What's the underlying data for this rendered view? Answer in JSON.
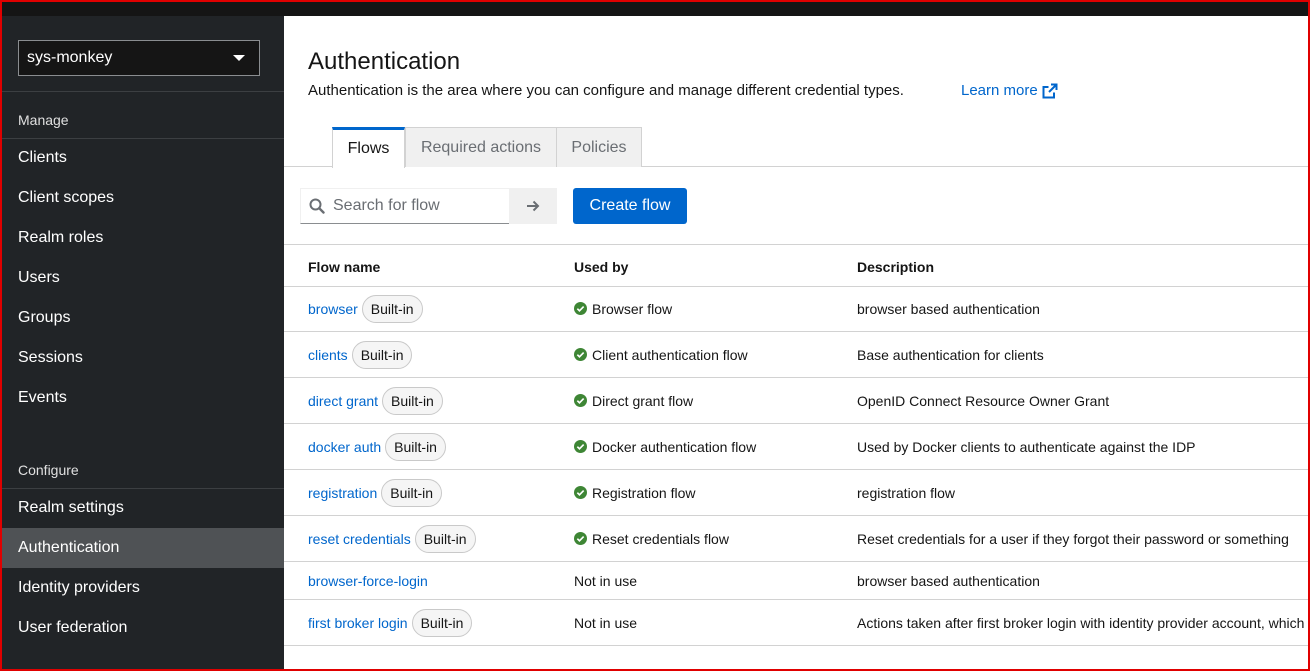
{
  "realm_selector": {
    "value": "sys-monkey"
  },
  "sidebar": {
    "manage_title": "Manage",
    "manage_items": [
      {
        "label": "Clients"
      },
      {
        "label": "Client scopes"
      },
      {
        "label": "Realm roles"
      },
      {
        "label": "Users"
      },
      {
        "label": "Groups"
      },
      {
        "label": "Sessions"
      },
      {
        "label": "Events"
      }
    ],
    "configure_title": "Configure",
    "configure_items": [
      {
        "label": "Realm settings"
      },
      {
        "label": "Authentication"
      },
      {
        "label": "Identity providers"
      },
      {
        "label": "User federation"
      }
    ],
    "active_item": "Authentication"
  },
  "header": {
    "title": "Authentication",
    "description": "Authentication is the area where you can configure and manage different credential types.",
    "learn_more": "Learn more"
  },
  "tabs": [
    {
      "label": "Flows",
      "active": true
    },
    {
      "label": "Required actions",
      "active": false
    },
    {
      "label": "Policies",
      "active": false
    }
  ],
  "toolbar": {
    "search_placeholder": "Search for flow",
    "create_label": "Create flow"
  },
  "table": {
    "columns": [
      "Flow name",
      "Used by",
      "Description"
    ],
    "rows": [
      {
        "name": "browser",
        "badge": "Built-in",
        "used_by": "Browser flow",
        "in_use": true,
        "description": "browser based authentication"
      },
      {
        "name": "clients",
        "badge": "Built-in",
        "used_by": "Client authentication flow",
        "in_use": true,
        "description": "Base authentication for clients"
      },
      {
        "name": "direct grant",
        "badge": "Built-in",
        "used_by": "Direct grant flow",
        "in_use": true,
        "description": "OpenID Connect Resource Owner Grant"
      },
      {
        "name": "docker auth",
        "badge": "Built-in",
        "used_by": "Docker authentication flow",
        "in_use": true,
        "description": "Used by Docker clients to authenticate against the IDP"
      },
      {
        "name": "registration",
        "badge": "Built-in",
        "used_by": "Registration flow",
        "in_use": true,
        "description": "registration flow"
      },
      {
        "name": "reset credentials",
        "badge": "Built-in",
        "used_by": "Reset credentials flow",
        "in_use": true,
        "description": "Reset credentials for a user if they forgot their password or something"
      },
      {
        "name": "browser-force-login",
        "badge": "",
        "used_by": "Not in use",
        "in_use": false,
        "description": "browser based authentication"
      },
      {
        "name": "first broker login",
        "badge": "Built-in",
        "used_by": "Not in use",
        "in_use": false,
        "description": "Actions taken after first broker login with identity provider account, which"
      }
    ]
  },
  "colors": {
    "accent": "#0066cc",
    "sidebar_bg": "#212427",
    "active_nav": "#4f5255",
    "success": "#3e8635",
    "frame": "#e00000"
  }
}
